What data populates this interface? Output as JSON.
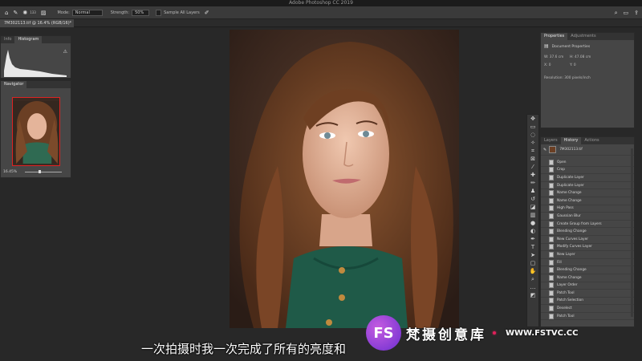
{
  "titlebar": {
    "title": "Adobe Photoshop CC 2019"
  },
  "options": {
    "size": "133",
    "mode_label": "Mode:",
    "mode_value": "Normal",
    "strength_label": "Strength:",
    "strength_value": "50%",
    "sample_label": "Sample All Layers"
  },
  "document": {
    "tab_title": "7M302113.tif @ 16.4% (RGB/16)*"
  },
  "left_panels": {
    "tabs": [
      "Info",
      "Histogram"
    ],
    "navigator": {
      "title": "Navigator",
      "zoom": "16.45%"
    }
  },
  "properties": {
    "tabs": [
      "Properties",
      "Adjustments"
    ],
    "heading": "Document Properties",
    "w": "W: 37.6 cm",
    "h": "H: 47.08 cm",
    "x": "X: 0",
    "y": "Y: 0",
    "resolution": "Resolution: 300 pixels/inch"
  },
  "history": {
    "tabs": [
      "Layers",
      "History",
      "Actions"
    ],
    "snapshot": "7M302113.tif",
    "items": [
      "Open",
      "Crop",
      "Duplicate Layer",
      "Duplicate Layer",
      "Name Change",
      "Name Change",
      "High Pass",
      "Gaussian Blur",
      "Create Group from Layers",
      "Blending Change",
      "New Curves Layer",
      "Modify Curves Layer",
      "New Layer",
      "Fill",
      "Blending Change",
      "Name Change",
      "Layer Order",
      "Patch Tool",
      "Patch Selection",
      "Deselect",
      "Patch Tool"
    ]
  },
  "subtitle": "一次拍摄时我一次完成了所有的亮度和",
  "watermark": {
    "name": "梵摄创意库",
    "site": "WWW.FSTVC.CC",
    "logo": "FS"
  },
  "colors": {
    "accent": "#c55be0",
    "bg": "#282828"
  }
}
